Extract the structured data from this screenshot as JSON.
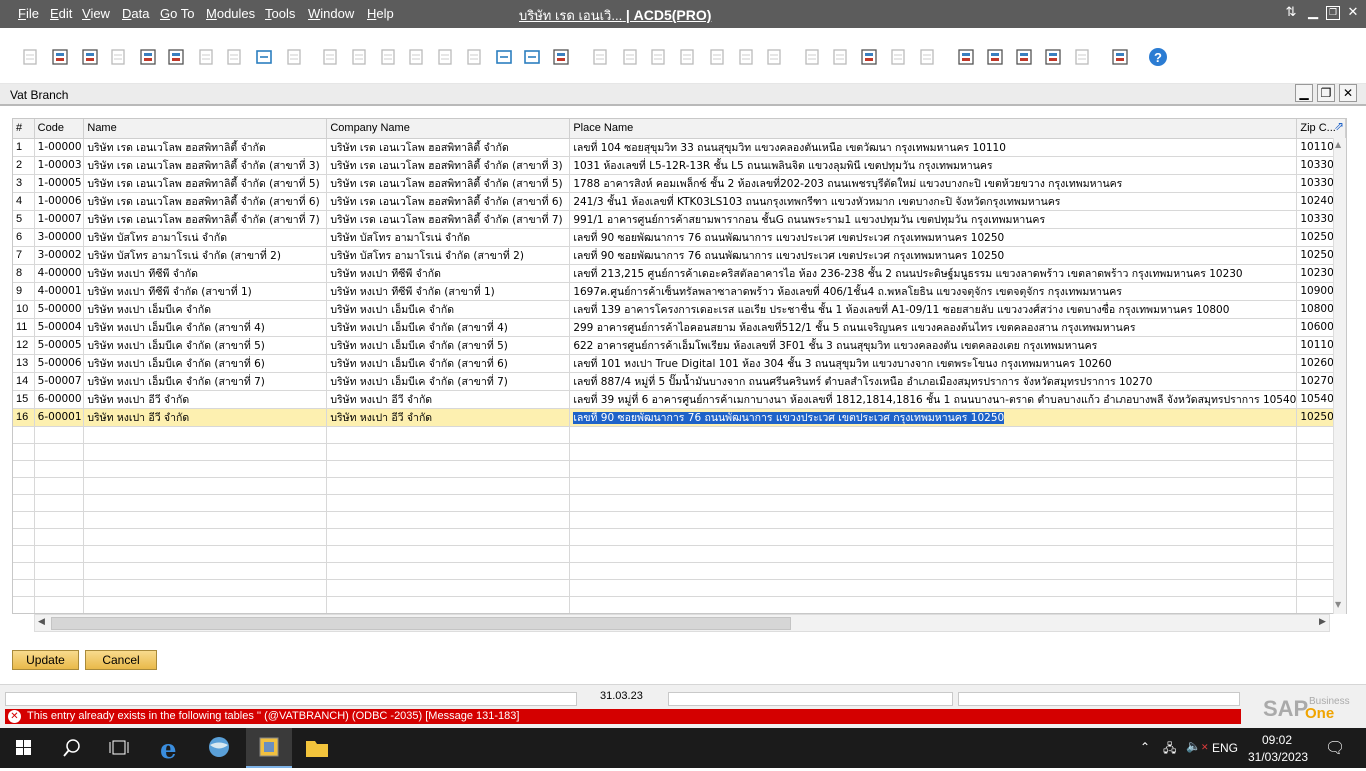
{
  "menubar": {
    "items": [
      {
        "label": "File",
        "u": "F",
        "rest": "ile"
      },
      {
        "label": "Edit",
        "u": "E",
        "rest": "dit"
      },
      {
        "label": "View",
        "u": "V",
        "rest": "iew"
      },
      {
        "label": "Data",
        "u": "D",
        "rest": "ata"
      },
      {
        "label": "Go To",
        "u": "G",
        "rest": "o To"
      },
      {
        "label": "Modules",
        "u": "M",
        "rest": "odules"
      },
      {
        "label": "Tools",
        "u": "T",
        "rest": "ools"
      },
      {
        "label": "Window",
        "u": "W",
        "rest": "indow"
      },
      {
        "label": "Help",
        "u": "H",
        "rest": "elp"
      }
    ],
    "company": "บริษัท เรด เอนเวิ...",
    "database": "| ACD5(PRO)"
  },
  "window": {
    "title": "Vat Branch"
  },
  "grid": {
    "columns": [
      "#",
      "Code",
      "Name",
      "Company Name",
      "Place Name",
      "Zip C..."
    ],
    "rows": [
      [
        "1",
        "1-00000",
        "บริษัท เรด เอนเวโลพ ฮอสพิทาลิตี้ จำกัด",
        "บริษัท เรด เอนเวโลพ ฮอสพิทาลิตี้ จำกัด",
        "เลขที่ 104 ซอยสุขุมวิท 33 ถนนสุขุมวิท แขวงคลองตันเหนือ เขตวัฒนา กรุงเทพมหานคร 10110",
        "10110"
      ],
      [
        "2",
        "1-00003",
        "บริษัท เรด เอนเวโลพ ฮอสพิทาลิตี้ จำกัด (สาขาที่ 3)",
        "บริษัท เรด เอนเวโลพ ฮอสพิทาลิตี้ จำกัด (สาขาที่ 3)",
        "1031 ห้องเลขที่ L5-12R-13R ชั้น L5 ถนนเพลินจิต แขวงลุมพินี เขตปทุมวัน กรุงเทพมหานคร",
        "10330"
      ],
      [
        "3",
        "1-00005",
        "บริษัท เรด เอนเวโลพ ฮอสพิทาลิตี้ จำกัด (สาขาที่ 5)",
        "บริษัท เรด เอนเวโลพ ฮอสพิทาลิตี้ จำกัด (สาขาที่ 5)",
        "1788 อาคารสิงห์ คอมเพล็กซ์ ชั้น 2 ห้องเลขที่202-203 ถนนเพชรบุรีตัดใหม่ แขวงบางกะปิ เขตห้วยขวาง กรุงเทพมหานคร",
        "10330"
      ],
      [
        "4",
        "1-00006",
        "บริษัท เรด เอนเวโลพ ฮอสพิทาลิตี้ จำกัด (สาขาที่ 6)",
        "บริษัท เรด เอนเวโลพ ฮอสพิทาลิตี้ จำกัด (สาขาที่ 6)",
        "241/3 ชั้น1 ห้องเลขที่ KTK03LS103 ถนนกรุงเทพกรีฑา แขวงหัวหมาก เขตบางกะปิ จังหวัดกรุงเทพมหานคร",
        "10240"
      ],
      [
        "5",
        "1-00007",
        "บริษัท เรด เอนเวโลพ ฮอสพิทาลิตี้ จำกัด (สาขาที่ 7)",
        "บริษัท เรด เอนเวโลพ ฮอสพิทาลิตี้ จำกัด (สาขาที่ 7)",
        "991/1 อาคารศูนย์การค้าสยามพารากอน ชั้นG ถนนพระราม1 แขวงปทุมวัน เขตปทุมวัน กรุงเทพมหานคร",
        "10330"
      ],
      [
        "6",
        "3-00000",
        "บริษัท บัสโทร อามาโรเน่ จำกัด",
        "บริษัท บัสโทร อามาโรเน่ จำกัด",
        "เลขที่ 90 ซอยพัฒนาการ 76 ถนนพัฒนาการ แขวงประเวศ เขตประเวศ กรุงเทพมหานคร 10250",
        "10250"
      ],
      [
        "7",
        "3-00002",
        "บริษัท บัสโทร อามาโรเน่ จำกัด (สาขาที่ 2)",
        "บริษัท บัสโทร อามาโรเน่ จำกัด (สาขาที่ 2)",
        "เลขที่ 90 ซอยพัฒนาการ 76 ถนนพัฒนาการ แขวงประเวศ เขตประเวศ กรุงเทพมหานคร 10250",
        "10250"
      ],
      [
        "8",
        "4-00000",
        "บริษัท หงเปา ทีซีพี จำกัด",
        "บริษัท หงเปา ทีซีพี จำกัด",
        "เลขที่ 213,215 ศูนย์การค้าเดอะคริสตัลอาคารไอ ห้อง 236-238 ชั้น 2 ถนนประดิษฐ์มนูธรรม แขวงลาดพร้าว เขตลาดพร้าว กรุงเทพมหานคร 10230",
        "10230"
      ],
      [
        "9",
        "4-00001",
        "บริษัท หงเปา ทีซีพี จำกัด (สาขาที่ 1)",
        "บริษัท หงเปา ทีซีพี จำกัด (สาขาที่ 1)",
        "1697ค.ศูนย์การค้าเซ็นทรัลพลาซาลาดพร้าว ห้องเลขที่ 406/1ชั้น4 ถ.พหลโยธิน แขวงจตุจักร เขตจตุจักร กรุงเทพมหานคร",
        "10900"
      ],
      [
        "10",
        "5-00000",
        "บริษัท หงเปา เอ็มบีเค จำกัด",
        "บริษัท หงเปา เอ็มบีเค จำกัด",
        "เลขที่ 139 อาคารโครงการเดอะเรส แอเรีย ประชาชื่น ชั้น 1 ห้องเลขที่ A1-09/11 ซอยสายลับ แขวงวงศ์สว่าง เขตบางซื่อ กรุงเทพมหานคร 10800",
        "10800"
      ],
      [
        "11",
        "5-00004",
        "บริษัท หงเปา เอ็มบีเค จำกัด (สาขาที่ 4)",
        "บริษัท หงเปา เอ็มบีเค จำกัด (สาขาที่ 4)",
        "299 อาคารศูนย์การค้าไอคอนสยาม ห้องเลขที่512/1 ชั้น 5 ถนนเจริญนคร แขวงคลองต้นไทร เขตคลองสาน กรุงเทพมหานคร",
        "10600"
      ],
      [
        "12",
        "5-00005",
        "บริษัท หงเปา เอ็มบีเค จำกัด (สาขาที่ 5)",
        "บริษัท หงเปา เอ็มบีเค จำกัด (สาขาที่ 5)",
        "622 อาคารศูนย์การค้าเอ็มโพเรียม ห้องเลขที่ 3F01 ชั้น 3 ถนนสุขุมวิท แขวงคลองตัน เขตคลองเตย กรุงเทพมหานคร",
        "10110"
      ],
      [
        "13",
        "5-00006",
        "บริษัท หงเปา เอ็มบีเค จำกัด (สาขาที่ 6)",
        "บริษัท หงเปา เอ็มบีเค จำกัด (สาขาที่ 6)",
        "เลขที่ 101 หงเปา True Digital 101 ห้อง 304 ชั้น 3 ถนนสุขุมวิท แขวงบางจาก เขตพระโขนง กรุงเทพมหานคร 10260",
        "10260"
      ],
      [
        "14",
        "5-00007",
        "บริษัท หงเปา เอ็มบีเค จำกัด (สาขาที่ 7)",
        "บริษัท หงเปา เอ็มบีเค จำกัด (สาขาที่ 7)",
        "เลขที่ 887/4 หมู่ที่ 5 ปั๊มน้ำมันบางจาก ถนนศรีนครินทร์ ตำบลสำโรงเหนือ อำเภอเมืองสมุทรปราการ จังหวัดสมุทรปราการ 10270",
        "10270"
      ],
      [
        "15",
        "6-00000",
        "บริษัท หงเปา อีวี จำกัด",
        "บริษัท หงเปา อีวี จำกัด",
        "เลขที่ 39 หมู่ที่ 6 อาคารศูนย์การค้าเมกาบางนา ห้องเลขที่ 1812,1814,1816 ชั้น 1 ถนนบางนา-ตราด ตำบลบางแก้ว อำเภอบางพลี จังหวัดสมุทรปราการ 10540",
        "10540"
      ],
      [
        "16",
        "6-00001",
        "บริษัท หงเปา อีวี จำกัด",
        "บริษัท หงเปา อีวี จำกัด",
        "เลขที่ 90 ซอยพัฒนาการ 76 ถนนพัฒนาการ แขวงประเวศ เขตประเวศ กรุงเทพมหานคร 10250",
        "10250"
      ]
    ],
    "empty_rows": 12
  },
  "buttons": {
    "update": "Update",
    "cancel": "Cancel"
  },
  "status": {
    "date": "31.03.23",
    "error_message": "This entry already exists in the following tables  '' (@VATBRANCH) (ODBC -2035)  [Message 131-183]"
  },
  "sap_logo": {
    "sap": "SAP",
    "business": "Business",
    "one": "One"
  },
  "taskbar": {
    "language": "ENG",
    "time": "09:02",
    "date": "31/03/2023"
  },
  "colors": {
    "error": "#d40000",
    "accent": "#e9b94a",
    "selection": "#1e62c8"
  }
}
